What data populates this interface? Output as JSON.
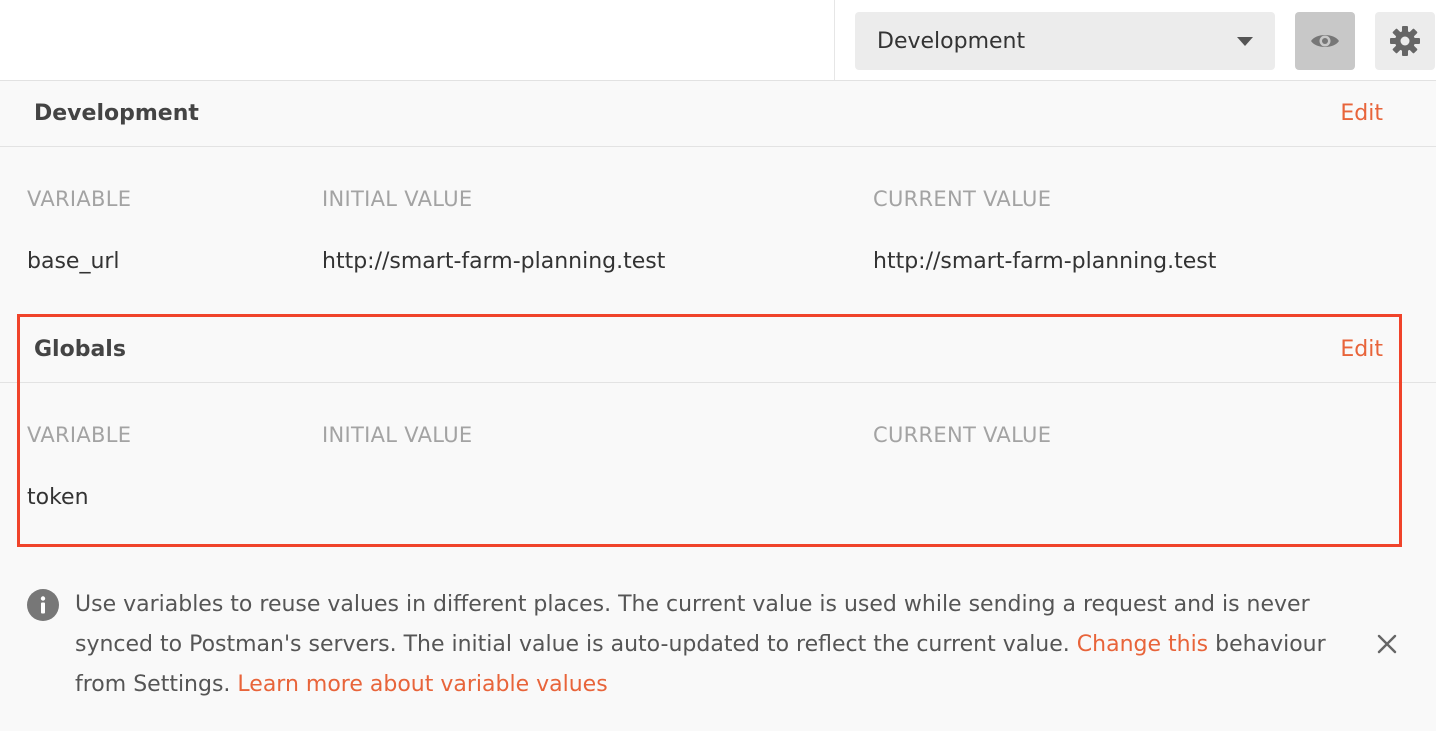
{
  "environment_selector": {
    "selected": "Development"
  },
  "icons": {
    "quick_look": "eye-icon",
    "settings": "gear-icon",
    "info": "info-icon",
    "close": "close-icon",
    "dropdown": "chevron-down-icon"
  },
  "colors": {
    "accent": "#e8643a",
    "highlight_border": "#f0432a"
  },
  "environment_section": {
    "title": "Development",
    "edit_label": "Edit",
    "columns": [
      "VARIABLE",
      "INITIAL VALUE",
      "CURRENT VALUE"
    ],
    "rows": [
      {
        "variable": "base_url",
        "initial_value": "http://smart-farm-planning.test",
        "current_value": "http://smart-farm-planning.test"
      }
    ]
  },
  "globals_section": {
    "title": "Globals",
    "edit_label": "Edit",
    "columns": [
      "VARIABLE",
      "INITIAL VALUE",
      "CURRENT VALUE"
    ],
    "rows": [
      {
        "variable": "token",
        "initial_value": "",
        "current_value": ""
      }
    ]
  },
  "notice": {
    "text_part1": "Use variables to reuse values in different places. The current value is used while sending a request and is never synced to Postman's servers. The initial value is auto-updated to reflect the current value. ",
    "link1": "Change this",
    "text_part2": " behaviour from Settings. ",
    "link2": "Learn more about variable values"
  }
}
